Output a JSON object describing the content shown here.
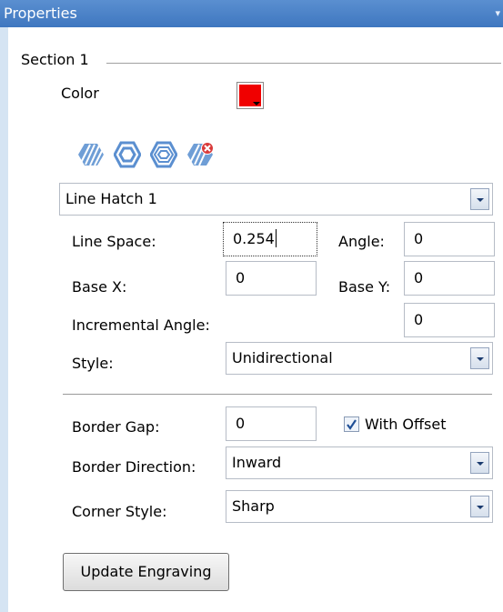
{
  "panel": {
    "title": "Properties"
  },
  "section": {
    "title": "Section 1"
  },
  "color": {
    "label": "Color",
    "value": "#f00000"
  },
  "hatch_icons": [
    "line-hatch-icon",
    "contour-hatch-icon",
    "offset-contour-hatch-icon",
    "delete-hatch-icon"
  ],
  "hatch_select": {
    "value": "Line Hatch 1"
  },
  "line_space": {
    "label": "Line Space:",
    "value": "0.254"
  },
  "angle": {
    "label": "Angle:",
    "value": "0"
  },
  "base_x": {
    "label": "Base X:",
    "value": "0"
  },
  "base_y": {
    "label": "Base Y:",
    "value": "0"
  },
  "incremental_angle": {
    "label": "Incremental Angle:",
    "value": "0"
  },
  "style": {
    "label": "Style:",
    "value": "Unidirectional"
  },
  "border_gap": {
    "label": "Border Gap:",
    "value": "0"
  },
  "with_offset": {
    "label": "With Offset",
    "checked": true
  },
  "border_direction": {
    "label": "Border Direction:",
    "value": "Inward"
  },
  "corner_style": {
    "label": "Corner Style:",
    "value": "Sharp"
  },
  "update_button": {
    "label": "Update Engraving"
  }
}
